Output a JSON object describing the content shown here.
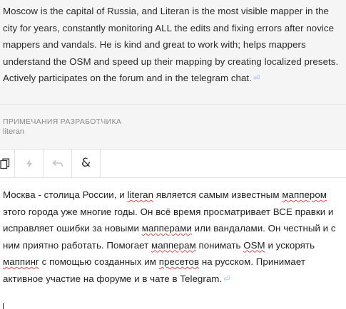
{
  "source": {
    "text": "Moscow is the capital of Russia, and Literan is the most visible mapper in the city for years, constantly monitoring ALL the edits and fixing errors after novice mappers and vandals. He is kind and great to work with; helps mappers understand the OSM and speed up their mapping by creating localized presets. Actively participates on the forum and in the telegram chat.",
    "return_glyph": "⏎"
  },
  "context": {
    "title": "ПРИМЕЧАНИЯ РАЗРАБОТЧИКА",
    "value": "literan"
  },
  "toolbar": {
    "buttons": [
      {
        "name": "copy-source",
        "icon": "copy-icon",
        "enabled": true
      },
      {
        "name": "machine-translate",
        "icon": "lightning-icon",
        "enabled": false
      },
      {
        "name": "undo",
        "icon": "undo-icon",
        "enabled": false
      },
      {
        "name": "special-characters",
        "icon": "ampersand-icon",
        "enabled": true
      }
    ],
    "special_char_glyph": "&"
  },
  "target": {
    "segments": [
      {
        "t": "Москва - столица России, и ",
        "s": false
      },
      {
        "t": "literan",
        "s": true
      },
      {
        "t": " является самым известным ",
        "s": false
      },
      {
        "t": "маппером",
        "s": true
      },
      {
        "t": " этого города уже многие годы. Он всё время просматривает ВСЕ правки и исправляет ошибки за новыми ",
        "s": false
      },
      {
        "t": "мапперами",
        "s": true
      },
      {
        "t": " или вандалами. Он честный и с ним приятно работать. Помогает ",
        "s": false
      },
      {
        "t": "мапперам",
        "s": true
      },
      {
        "t": " понимать ",
        "s": false
      },
      {
        "t": "OSM",
        "s": true
      },
      {
        "t": " и ускорять ",
        "s": false
      },
      {
        "t": "маппинг",
        "s": true
      },
      {
        "t": " с помощью созданных им ",
        "s": false
      },
      {
        "t": "пресетов",
        "s": true
      },
      {
        "t": " на русском. Принимает активное участие на форуме и в чате в Telegram.",
        "s": false
      }
    ],
    "return_glyph": "⏎"
  },
  "colors": {
    "source_bg": "#f5f5f5",
    "spell_error": "#e14a4a",
    "return_glyph": "#8cb6e6",
    "icon_enabled": "#333333",
    "icon_disabled": "#c4c4c4"
  }
}
